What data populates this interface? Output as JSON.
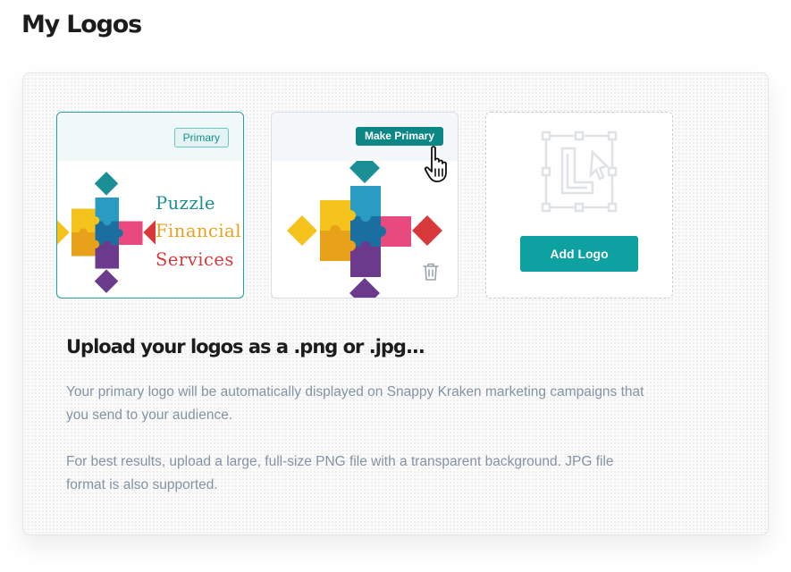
{
  "page": {
    "title": "My Logos"
  },
  "logos": [
    {
      "badge": "Primary",
      "text_lines": [
        "Puzzle",
        "Financial",
        "Services"
      ],
      "puzzle_colors": [
        "#1a8f96",
        "#f5c31b",
        "#e8a21a",
        "#d9383a",
        "#e84a7f",
        "#6b3a8c",
        "#2a9bc2"
      ]
    },
    {
      "action_label": "Make Primary",
      "delete_icon": "trash-icon",
      "cursor_icon": "hand-pointer-icon"
    }
  ],
  "add_card": {
    "icon": "logo-placeholder-icon",
    "button_label": "Add Logo"
  },
  "info": {
    "heading": "Upload your logos as a .png or .jpg...",
    "paragraphs": [
      "Your primary logo will be automatically displayed on Snappy Kraken marketing campaigns that you send to your audience.",
      "For best results, upload a large, full-size PNG file with a transparent background. JPG file format is also supported."
    ]
  },
  "colors": {
    "accent": "#0ea1a1",
    "accent_dark": "#0d8686",
    "heading": "#1c1c1c",
    "body_text": "#8493a5"
  }
}
